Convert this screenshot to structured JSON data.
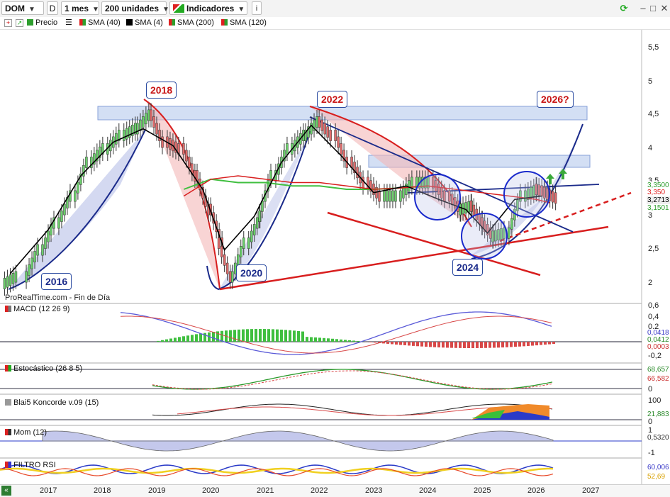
{
  "toolbar": {
    "symbol": "DOM",
    "symbol_badge": "D",
    "period": "1 mes",
    "units": "200 unidades",
    "indicators": "Indicadores",
    "info_icon": "info-icon",
    "window_buttons": [
      "–",
      "□",
      "✕"
    ]
  },
  "subbar": {
    "items": [
      {
        "label": "Precio",
        "color": "#2e9e2e"
      },
      {
        "label": "SMA (40)",
        "color": "#2e9e2e"
      },
      {
        "label": "SMA (4)",
        "color": "#000000"
      },
      {
        "label": "SMA (200)",
        "color": "#2e9e2e"
      },
      {
        "label": "SMA (120)",
        "color": "#e02020"
      }
    ]
  },
  "chart_data": [
    {
      "type": "candlestick",
      "title": "DOM",
      "source_note": "ProRealTime.com - Fin de Día",
      "x_ticks": [
        "2017",
        "2018",
        "2019",
        "2020",
        "2021",
        "2022",
        "2023",
        "2024",
        "2025",
        "2026",
        "2027"
      ],
      "y_ticks": [
        "5,5",
        "5",
        "4,5",
        "4",
        "3,5",
        "3",
        "2,5",
        "2"
      ],
      "ylim": [
        1.8,
        5.9
      ],
      "price_tags": [
        {
          "label": "3,3500",
          "color": "#2e9e2e"
        },
        {
          "label": "3,350",
          "color": "#e02020"
        },
        {
          "label": "3,2713",
          "color": "#000000"
        },
        {
          "label": "3,1501",
          "color": "#2e9e2e"
        }
      ],
      "annotations": [
        "2016",
        "2018",
        "2020",
        "2022",
        "2024",
        "2026?"
      ],
      "series": [
        {
          "name": "Precio",
          "x": [
            2016.3,
            2016.7,
            2017.0,
            2017.3,
            2017.6,
            2017.9,
            2018.2,
            2018.5,
            2018.75,
            2019.0,
            2019.3,
            2019.6,
            2019.85,
            2020.1,
            2020.25,
            2020.5,
            2020.8,
            2021.0,
            2021.3,
            2021.6,
            2021.85,
            2022.1,
            2022.4,
            2022.7,
            2023.0,
            2023.3,
            2023.6,
            2023.9,
            2024.2,
            2024.5,
            2024.7,
            2024.9,
            2025.1,
            2025.3,
            2025.6,
            2025.9,
            2026.1,
            2026.25
          ],
          "values": [
            2.1,
            2.5,
            2.9,
            3.3,
            3.8,
            4.0,
            4.2,
            4.3,
            4.5,
            4.1,
            4.0,
            3.6,
            3.1,
            2.6,
            2.1,
            2.6,
            3.0,
            3.6,
            4.0,
            4.2,
            4.4,
            4.2,
            3.8,
            3.5,
            3.3,
            3.3,
            3.5,
            3.5,
            3.3,
            3.1,
            3.15,
            2.9,
            2.7,
            2.75,
            3.3,
            3.4,
            3.35,
            3.27
          ]
        },
        {
          "name": "SMA (4)",
          "x": [
            2016.3,
            2017.0,
            2017.6,
            2018.2,
            2018.75,
            2019.3,
            2019.85,
            2020.25,
            2020.8,
            2021.3,
            2021.85,
            2022.4,
            2023.0,
            2023.6,
            2024.2,
            2024.7,
            2025.1,
            2025.6,
            2026.1
          ],
          "values": [
            2.15,
            2.8,
            3.6,
            4.1,
            4.3,
            4.05,
            3.4,
            2.5,
            3.0,
            3.8,
            4.35,
            3.9,
            3.35,
            3.45,
            3.25,
            3.1,
            2.75,
            3.25,
            3.3
          ]
        },
        {
          "name": "SMA (200)",
          "x": [
            2019.5,
            2020.0,
            2020.5,
            2021.0,
            2021.5,
            2022.0,
            2022.5,
            2023.0,
            2023.5,
            2024.0
          ],
          "values": [
            3.4,
            3.55,
            3.5,
            3.5,
            3.45,
            3.45,
            3.4,
            3.4,
            3.42,
            3.45
          ]
        },
        {
          "name": "SMA (120)",
          "x": [
            2019.5,
            2020.0,
            2020.5,
            2021.0,
            2021.5,
            2022.0,
            2022.5,
            2023.0,
            2023.5,
            2024.0,
            2024.5,
            2025.0,
            2025.5,
            2026.0,
            2026.25
          ],
          "values": [
            3.3,
            3.55,
            3.6,
            3.55,
            3.5,
            3.5,
            3.45,
            3.4,
            3.42,
            3.45,
            3.4,
            3.35,
            3.3,
            3.25,
            3.2
          ]
        }
      ]
    },
    {
      "type": "line",
      "title": "MACD (12 26 9)",
      "y_ticks": [
        "0,6",
        "0,4",
        "0,2",
        "0",
        "-0,2"
      ],
      "value_tags": [
        "0,0418",
        "0,0412",
        "0,0003"
      ]
    },
    {
      "type": "line",
      "title": "Estocástico (26 8 5)",
      "y_ticks": [
        "100",
        "0"
      ],
      "value_tags": [
        "68,657",
        "66,582"
      ]
    },
    {
      "type": "area",
      "title": "Blai5 Koncorde v.09 (15)",
      "y_ticks": [
        "100",
        "0"
      ],
      "value_tags": [
        "21,883"
      ]
    },
    {
      "type": "area",
      "title": "Mom (12)",
      "y_ticks": [
        "1",
        "0",
        "-1"
      ],
      "value_tags": [
        "0,5320"
      ]
    },
    {
      "type": "area",
      "title": "FILTRO RSI",
      "y_ticks": [
        "50"
      ],
      "value_tags": [
        "60,006",
        "52,69"
      ]
    }
  ]
}
